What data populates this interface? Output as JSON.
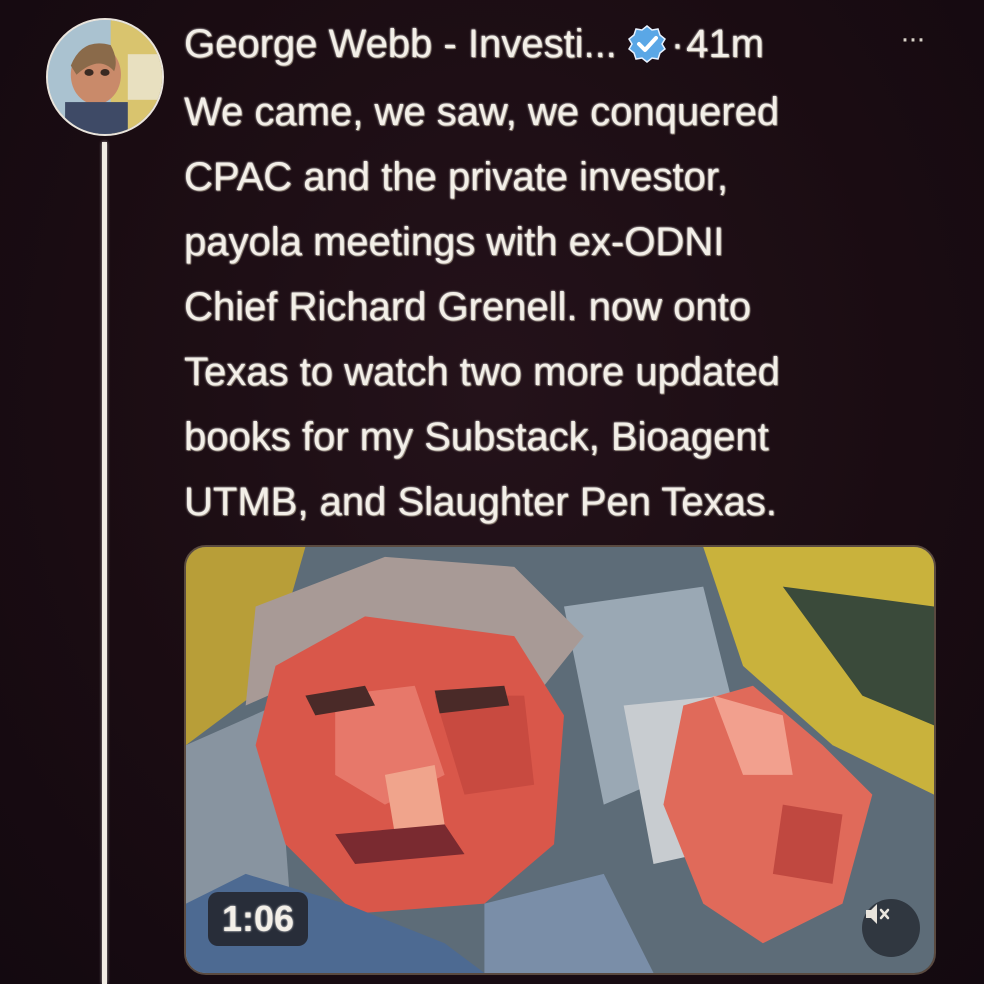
{
  "tweet": {
    "author_name": "George Webb - Investi...",
    "separator": "·",
    "time": "41m",
    "more_label": "···",
    "text_lines": [
      "We came, we saw, we conquered",
      "CPAC and the private investor,",
      "payola meetings with ex-ODNI",
      "Chief Richard Grenell. now onto",
      "Texas to watch two more updated",
      "books for my Substack, Bioagent",
      "UTMB, and Slaughter Pen Texas."
    ],
    "media": {
      "duration": "1:06",
      "mute_icon": "speaker-muted-icon"
    },
    "verified_icon": "verified-badge-icon",
    "colors": {
      "background": "#1a0d12",
      "text": "#f3efe8",
      "verified": "#5aa7e6"
    }
  }
}
